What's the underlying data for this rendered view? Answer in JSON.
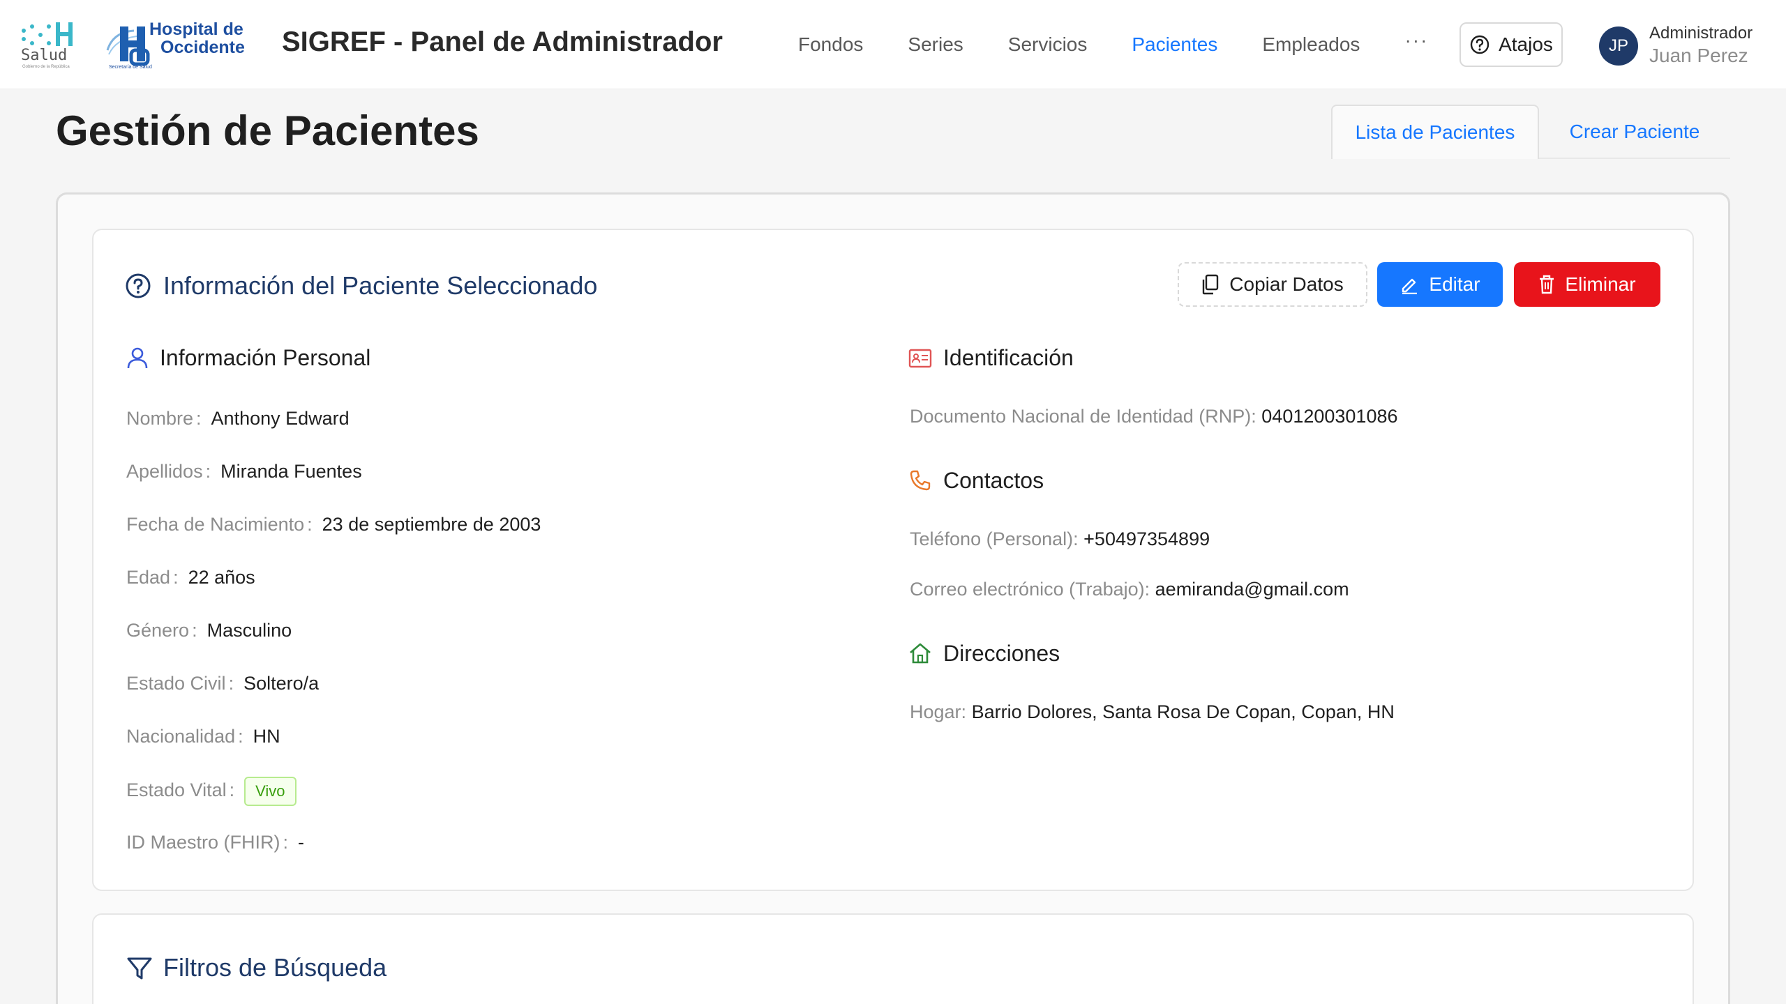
{
  "header": {
    "logo_salud": {
      "text": "Salud",
      "subtext": "Gobierno de la República"
    },
    "logo_hospital": {
      "line1": "Hospital de",
      "line2": "Occidente",
      "subtext": "Secretaría de Salud"
    },
    "app_title": "SIGREF - Panel de Administrador",
    "nav": [
      "Fondos",
      "Series",
      "Servicios",
      "Pacientes",
      "Empleados"
    ],
    "nav_active": "Pacientes",
    "more": "···",
    "shortcuts_label": "Atajos",
    "user": {
      "initials": "JP",
      "role": "Administrador",
      "name": "Juan Perez"
    }
  },
  "page": {
    "title": "Gestión de Pacientes",
    "tabs": [
      "Lista de Pacientes",
      "Crear Paciente"
    ]
  },
  "patient_card": {
    "title": "Información del Paciente Seleccionado",
    "buttons": {
      "copy": "Copiar Datos",
      "edit": "Editar",
      "delete": "Eliminar"
    },
    "personal": {
      "heading": "Información Personal",
      "fields": [
        {
          "label": "Nombre",
          "value": "Anthony Edward"
        },
        {
          "label": "Apellidos",
          "value": "Miranda Fuentes"
        },
        {
          "label": "Fecha de Nacimiento",
          "value": "23 de septiembre de 2003"
        },
        {
          "label": "Edad",
          "value": "22 años"
        },
        {
          "label": "Género",
          "value": "Masculino"
        },
        {
          "label": "Estado Civil",
          "value": "Soltero/a"
        },
        {
          "label": "Nacionalidad",
          "value": "HN"
        },
        {
          "label": "Estado Vital",
          "value": "Vivo"
        },
        {
          "label": "ID Maestro (FHIR)",
          "value": "-"
        }
      ]
    },
    "identification": {
      "heading": "Identificación",
      "label": "Documento Nacional de Identidad (RNP):",
      "value": "0401200301086"
    },
    "contacts": {
      "heading": "Contactos",
      "phone_label": "Teléfono (Personal):",
      "phone_value": "+50497354899",
      "email_label": "Correo electrónico (Trabajo):",
      "email_value": "aemiranda@gmail.com"
    },
    "addresses": {
      "heading": "Direcciones",
      "label": "Hogar:",
      "value": "Barrio Dolores, Santa Rosa De Copan, Copan, HN"
    }
  },
  "filters_card": {
    "title": "Filtros de Búsqueda"
  },
  "colors": {
    "primary": "#1677ff",
    "danger": "#e8141b",
    "title_navy": "#1f3a68",
    "success": "#389e0d",
    "contacts_icon": "#e8782a",
    "address_icon": "#2e8b3a",
    "id_icon": "#e05555",
    "person_icon": "#3b5bdb"
  }
}
